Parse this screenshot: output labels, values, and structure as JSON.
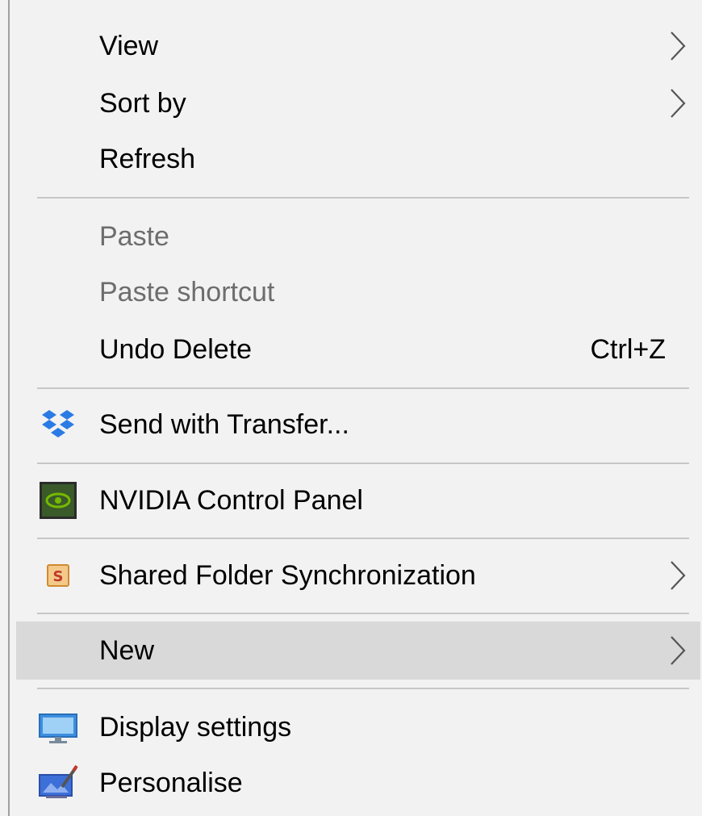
{
  "menu": {
    "items": [
      {
        "label": "View",
        "submenu": true
      },
      {
        "label": "Sort by",
        "submenu": true
      },
      {
        "label": "Refresh"
      },
      {
        "label": "Paste",
        "disabled": true
      },
      {
        "label": "Paste shortcut",
        "disabled": true
      },
      {
        "label": "Undo Delete",
        "shortcut": "Ctrl+Z"
      },
      {
        "label": "Send with Transfer...",
        "icon": "dropbox-icon"
      },
      {
        "label": "NVIDIA Control Panel",
        "icon": "nvidia-icon"
      },
      {
        "label": "Shared Folder Synchronization",
        "icon": "shared-folder-sync-icon",
        "submenu": true
      },
      {
        "label": "New",
        "submenu": true,
        "highlighted": true
      },
      {
        "label": "Display settings",
        "icon": "display-icon"
      },
      {
        "label": "Personalise",
        "icon": "personalise-icon"
      }
    ]
  },
  "colors": {
    "menu_background": "#f2f2f2",
    "highlight": "#d9d9d9",
    "disabled_text": "#6d6d6d",
    "separator": "#c7c7c7",
    "dropbox_blue": "#2a7be4",
    "nvidia_green": "#76b900"
  }
}
